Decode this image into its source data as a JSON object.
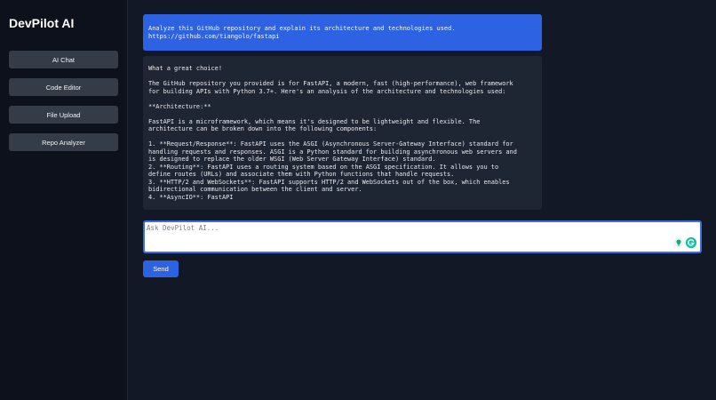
{
  "sidebar": {
    "brand": "DevPilot AI",
    "items": [
      {
        "label": "AI Chat"
      },
      {
        "label": "Code Editor"
      },
      {
        "label": "File Upload"
      },
      {
        "label": "Repo Analyzer"
      }
    ]
  },
  "chat": {
    "user_message": [
      "Analyze this GitHub repository and explain its architecture and technologies used.",
      "https://github.com/tiangolo/fastapi"
    ],
    "ai_message": [
      "What a great choice!",
      "",
      "The GitHub repository you provided is for FastAPI, a modern, fast (high-performance), web framework",
      "for building APIs with Python 3.7+. Here's an analysis of the architecture and technologies used:",
      "",
      "**Architecture:**",
      "",
      "FastAPI is a microframework, which means it's designed to be lightweight and flexible. The",
      "architecture can be broken down into the following components:",
      "",
      "1. **Request/Response**: FastAPI uses the ASGI (Asynchronous Server-Gateway Interface) standard for",
      "handling requests and responses. ASGI is a Python standard for building asynchronous web servers and",
      "is designed to replace the older WSGI (Web Server Gateway Interface) standard.",
      "2. **Routing**: FastAPI uses a routing system based on the ASGI specification. It allows you to",
      "define routes (URLs) and associate them with Python functions that handle requests.",
      "3. **HTTP/2 and WebSockets**: FastAPI supports HTTP/2 and WebSockets out of the box, which enables",
      "bidirectional communication between the client and server.",
      "4. **AsyncIO**: FastAPI"
    ]
  },
  "input": {
    "placeholder": "Ask DevPilot AI...",
    "value": ""
  },
  "send_label": "Send",
  "icons": {
    "extension_1": "bulb-icon",
    "extension_2": "grammarly-icon"
  },
  "colors": {
    "accent": "#2d63e3",
    "sidebar_bg": "#0c111c",
    "main_bg": "#121826",
    "ai_bubble": "#1e2533",
    "nav_button": "#353c48"
  }
}
